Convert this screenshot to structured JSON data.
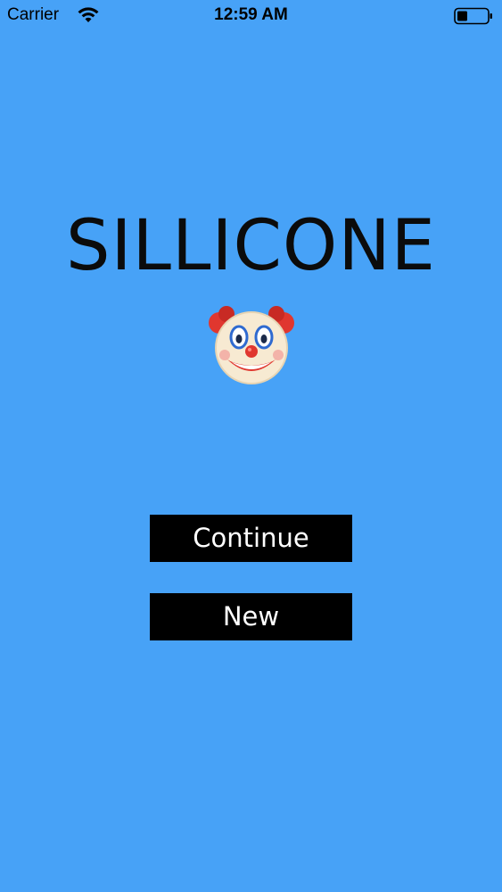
{
  "status_bar": {
    "carrier": "Carrier",
    "time": "12:59 AM",
    "wifi_icon": "wifi-icon",
    "battery_icon": "battery-icon"
  },
  "main": {
    "title": "SILLICONE",
    "mascot_icon": "clown-face-icon",
    "buttons": {
      "continue_label": "Continue",
      "new_label": "New"
    }
  },
  "colors": {
    "background": "#47a2f7",
    "button_bg": "#000000",
    "button_text": "#ffffff",
    "title_text": "#0b0b0b"
  }
}
